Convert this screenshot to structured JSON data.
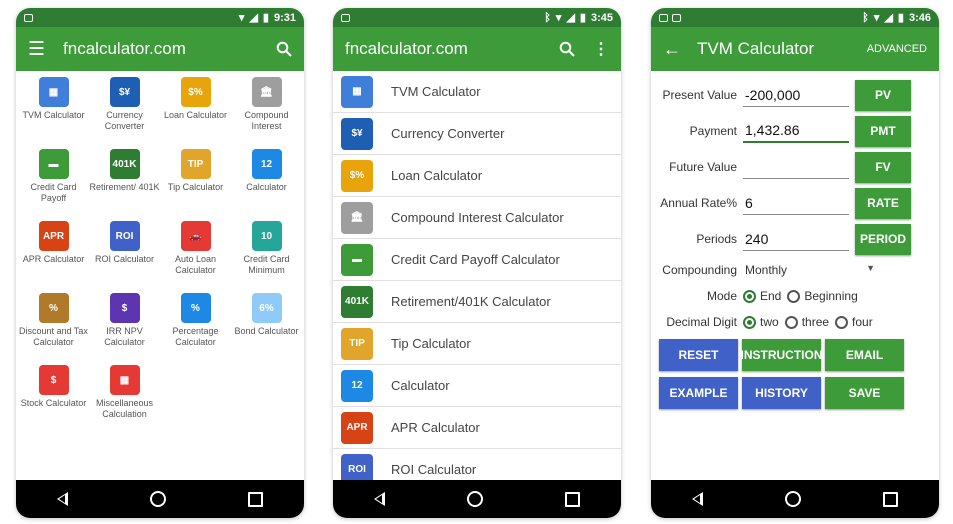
{
  "phone1": {
    "status": {
      "time": "9:31"
    },
    "title": "fncalculator.com",
    "grid": [
      {
        "label": "TVM Calculator",
        "icon": "tvm-calculator-icon",
        "color": "#3f7fd9",
        "glyph": "▦"
      },
      {
        "label": "Currency Converter",
        "icon": "currency-converter-icon",
        "color": "#1e5fb4",
        "glyph": "$¥"
      },
      {
        "label": "Loan Calculator",
        "icon": "loan-house-icon",
        "color": "#e8a40a",
        "glyph": "$%"
      },
      {
        "label": "Compound Interest",
        "icon": "bank-building-icon",
        "color": "#9e9e9e",
        "glyph": "🏛"
      },
      {
        "label": "Credit Card Payoff",
        "icon": "credit-card-icon",
        "color": "#3d9b3a",
        "glyph": "▬"
      },
      {
        "label": "Retirement/ 401K",
        "icon": "retirement-401k-icon",
        "color": "#2e7d32",
        "glyph": "401K"
      },
      {
        "label": "Tip Calculator",
        "icon": "tip-icon",
        "color": "#e0a52a",
        "glyph": "TIP"
      },
      {
        "label": "Calculator",
        "icon": "calculator-keys-icon",
        "color": "#1e88e5",
        "glyph": "12"
      },
      {
        "label": "APR Calculator",
        "icon": "apr-icon",
        "color": "#d84315",
        "glyph": "APR"
      },
      {
        "label": "ROI Calculator",
        "icon": "roi-icon",
        "color": "#3f61c8",
        "glyph": "ROI"
      },
      {
        "label": "Auto Loan Calculator",
        "icon": "car-icon",
        "color": "#e53935",
        "glyph": "🚗"
      },
      {
        "label": "Credit Card Minimum",
        "icon": "credit-card-minimum-icon",
        "color": "#26a69a",
        "glyph": "10"
      },
      {
        "label": "Discount and Tax Calculator",
        "icon": "discount-bag-icon",
        "color": "#b07a2a",
        "glyph": "%"
      },
      {
        "label": "IRR NPV Calculator",
        "icon": "irr-npv-icon",
        "color": "#5e35b1",
        "glyph": "$"
      },
      {
        "label": "Percentage Calculator",
        "icon": "percentage-icon",
        "color": "#1e88e5",
        "glyph": "%"
      },
      {
        "label": "Bond Calculator",
        "icon": "bond-icon",
        "color": "#90caf9",
        "glyph": "6%"
      },
      {
        "label": "Stock Calculator",
        "icon": "stock-chart-icon",
        "color": "#e53935",
        "glyph": "$"
      },
      {
        "label": "Miscellaneous Calculation",
        "icon": "misc-calculator-icon",
        "color": "#e53935",
        "glyph": "▦"
      }
    ]
  },
  "phone2": {
    "status": {
      "time": "3:45"
    },
    "title": "fncalculator.com",
    "list": [
      {
        "label": "TVM Calculator",
        "icon": "tvm-calculator-icon",
        "color": "#3f7fd9",
        "glyph": "▦"
      },
      {
        "label": "Currency Converter",
        "icon": "currency-converter-icon",
        "color": "#1e5fb4",
        "glyph": "$¥"
      },
      {
        "label": "Loan Calculator",
        "icon": "loan-house-icon",
        "color": "#e8a40a",
        "glyph": "$%"
      },
      {
        "label": "Compound Interest Calculator",
        "icon": "bank-building-icon",
        "color": "#9e9e9e",
        "glyph": "🏛"
      },
      {
        "label": "Credit Card Payoff Calculator",
        "icon": "credit-card-icon",
        "color": "#3d9b3a",
        "glyph": "▬"
      },
      {
        "label": "Retirement/401K Calculator",
        "icon": "retirement-401k-icon",
        "color": "#2e7d32",
        "glyph": "401K"
      },
      {
        "label": "Tip Calculator",
        "icon": "tip-icon",
        "color": "#e0a52a",
        "glyph": "TIP"
      },
      {
        "label": "Calculator",
        "icon": "calculator-keys-icon",
        "color": "#1e88e5",
        "glyph": "12"
      },
      {
        "label": "APR Calculator",
        "icon": "apr-icon",
        "color": "#d84315",
        "glyph": "APR"
      },
      {
        "label": "ROI Calculator",
        "icon": "roi-icon",
        "color": "#3f61c8",
        "glyph": "ROI"
      }
    ]
  },
  "phone3": {
    "status": {
      "time": "3:46"
    },
    "title": "TVM Calculator",
    "advanced": "ADVANCED",
    "fields": {
      "pv": {
        "label": "Present Value",
        "value": "-200,000",
        "btn": "PV"
      },
      "pmt": {
        "label": "Payment",
        "value": "1,432.86",
        "btn": "PMT"
      },
      "fv": {
        "label": "Future Value",
        "value": "",
        "btn": "FV"
      },
      "rate": {
        "label": "Annual Rate%",
        "value": "6",
        "btn": "RATE"
      },
      "periods": {
        "label": "Periods",
        "value": "240",
        "btn": "PERIOD"
      }
    },
    "compounding": {
      "label": "Compounding",
      "value": "Monthly"
    },
    "mode": {
      "label": "Mode",
      "options": [
        "End",
        "Beginning"
      ],
      "selected": "End"
    },
    "decimal": {
      "label": "Decimal Digit",
      "options": [
        "two",
        "three",
        "four"
      ],
      "selected": "two"
    },
    "buttons": {
      "reset": "RESET",
      "instruction": "INSTRUCTION",
      "email": "EMAIL",
      "example": "EXAMPLE",
      "history": "HISTORY",
      "save": "SAVE"
    }
  }
}
